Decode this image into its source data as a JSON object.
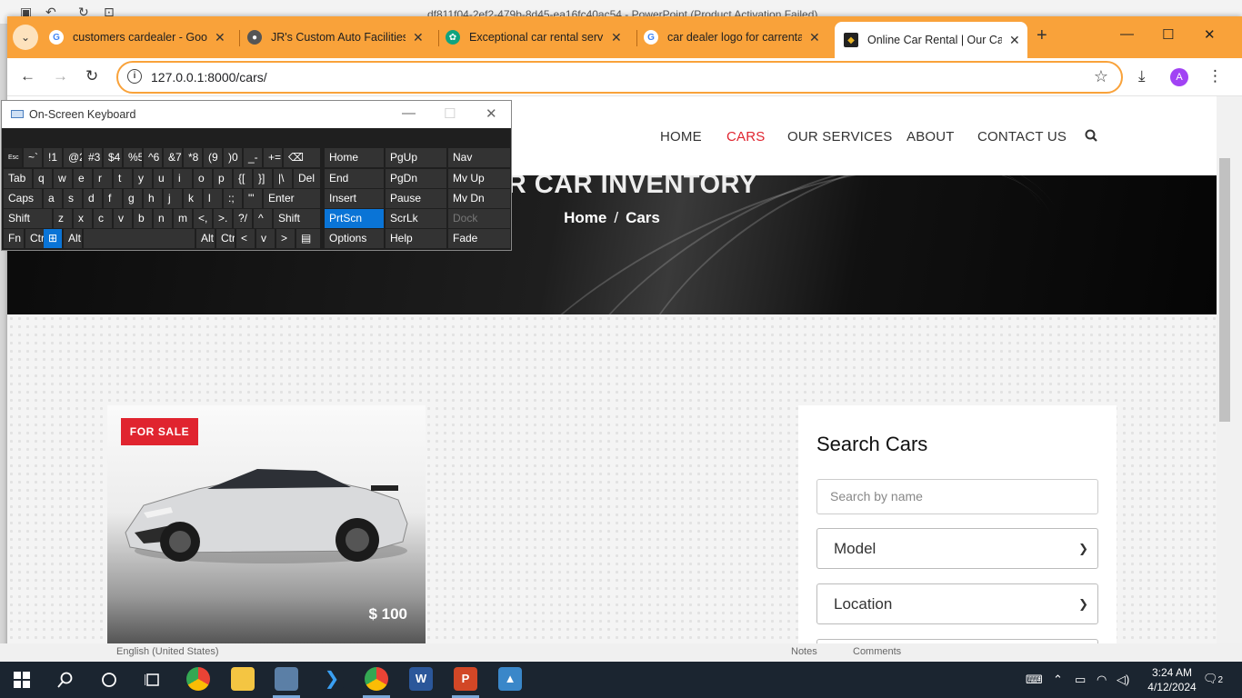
{
  "ppt": {
    "title": "df811f04-2ef2-479b-8d45-ea16fc40ac54 - PowerPoint (Product Activation Failed)",
    "status_language": "English (United States)",
    "status_notes": "Notes",
    "status_comments": "Comments"
  },
  "browser": {
    "tabs": [
      {
        "label": "customers cardealer - Goog",
        "favicon": "G",
        "color": "#4285f4"
      },
      {
        "label": "JR's Custom Auto Facilities",
        "favicon": "●",
        "color": "#555"
      },
      {
        "label": "Exceptional car rental servic",
        "favicon": "✿",
        "color": "#10a37f"
      },
      {
        "label": "car dealer logo for carrenta",
        "favicon": "G",
        "color": "#4285f4"
      },
      {
        "label": "Online Car Rental | Our Cars",
        "favicon": "◆",
        "color": "#8a6d1a"
      }
    ],
    "url": "127.0.0.1:8000/cars/",
    "profile_initial": "A"
  },
  "site": {
    "nav": [
      "HOME",
      "CARS",
      "OUR SERVICES",
      "ABOUT",
      "CONTACT US"
    ],
    "hero_title": "OUR CAR INVENTORY",
    "breadcrumb": {
      "home": "Home",
      "sep": "/",
      "current": "Cars"
    },
    "car": {
      "badge": "FOR SALE",
      "price": "$ 100"
    },
    "search": {
      "title": "Search Cars",
      "name_placeholder": "Search by name",
      "model_label": "Model",
      "location_label": "Location"
    }
  },
  "osk": {
    "title": "On-Screen Keyboard",
    "rows": [
      [
        "Esc",
        "~`",
        "!1",
        "@2",
        "#3",
        "$4",
        "%5",
        "^6",
        "&7",
        "*8",
        "(9",
        ")0",
        "_-",
        "+=",
        "⌫"
      ],
      [
        "Tab",
        "q",
        "w",
        "e",
        "r",
        "t",
        "y",
        "u",
        "i",
        "o",
        "p",
        "{[",
        "}]",
        "|\\",
        "Del"
      ],
      [
        "Caps",
        "a",
        "s",
        "d",
        "f",
        "g",
        "h",
        "j",
        "k",
        "l",
        ":;",
        "\"'",
        "Enter"
      ],
      [
        "Shift",
        "z",
        "x",
        "c",
        "v",
        "b",
        "n",
        "m",
        "<,",
        ">.",
        "?/",
        "^",
        "Shift"
      ],
      [
        "Fn",
        "Ctrl",
        "⊞",
        "Alt",
        "",
        "Alt",
        "Ctrl",
        "<",
        "v",
        ">",
        "▤"
      ]
    ],
    "nav_keys": [
      [
        "Home",
        "PgUp",
        "Nav"
      ],
      [
        "End",
        "PgDn",
        "Mv Up"
      ],
      [
        "Insert",
        "Pause",
        "Mv Dn"
      ],
      [
        "PrtScn",
        "ScrLk",
        "Dock"
      ],
      [
        "Options",
        "Help",
        "Fade"
      ]
    ]
  },
  "taskbar": {
    "time": "3:24 AM",
    "date": "4/12/2024",
    "notifications": "2"
  }
}
